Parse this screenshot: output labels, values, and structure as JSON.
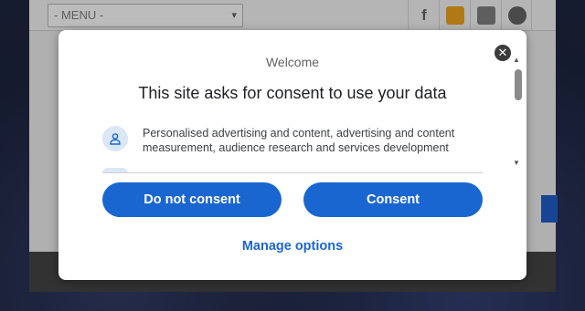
{
  "site": {
    "menu_value": "- MENU -",
    "social_icons": [
      "facebook-icon",
      "rss-icon",
      "youtube-icon",
      "discord-icon"
    ]
  },
  "dialog": {
    "welcome": "Welcome",
    "title": "This site asks for consent to use your data",
    "close_icon": "close-icon",
    "purposes": [
      {
        "icon": "person-icon",
        "text": "Personalised advertising and content, advertising and content measurement, audience research and services development"
      }
    ],
    "buttons": {
      "deny": "Do not consent",
      "accept": "Consent"
    },
    "manage_link": "Manage options"
  },
  "colors": {
    "primary": "#1a66d0",
    "icon_bg": "#dbe7f7"
  }
}
